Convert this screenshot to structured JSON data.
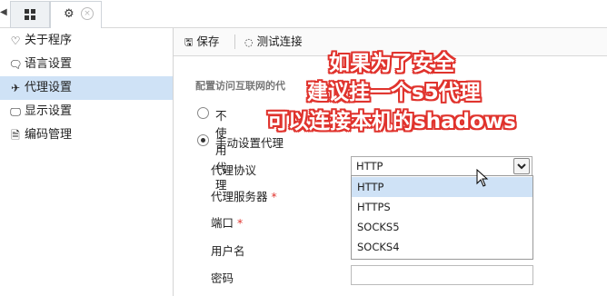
{
  "tabs": {
    "grid_icon": "grid-icon",
    "gear_icon": "gear-icon",
    "close_glyph": "×"
  },
  "sidebar": {
    "items": [
      {
        "icon": "♡",
        "label": "关于程序"
      },
      {
        "icon": "🗨",
        "label": "语言设置"
      },
      {
        "icon": "✈",
        "label": "代理设置"
      },
      {
        "icon": "🖵",
        "label": "显示设置"
      },
      {
        "icon": "🗎",
        "label": "编码管理"
      }
    ]
  },
  "toolbar": {
    "save_label": "保存",
    "test_label": "测试连接"
  },
  "form": {
    "section_title": "配置访问互联网的代",
    "radio_none": "不使用代理",
    "radio_manual": "手动设置代理",
    "protocol_label": "代理协议",
    "server_label": "代理服务器",
    "port_label": "端口",
    "username_label": "用户名",
    "password_label": "密码",
    "required_mark": "*",
    "protocol_value": "HTTP",
    "protocol_options": [
      "HTTP",
      "HTTPS",
      "SOCKS5",
      "SOCKS4"
    ]
  },
  "overlay": {
    "line1": "如果为了安全",
    "line2": "建议挂一个s5代理",
    "line3": "可以连接本机的shadows",
    "color": "#e0342e"
  }
}
